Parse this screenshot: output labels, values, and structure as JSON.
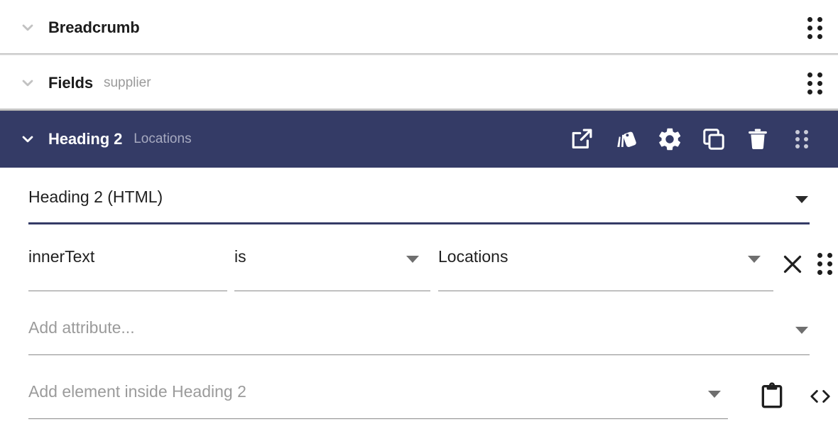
{
  "theme": {
    "accent": "#343b66",
    "selected_header_bg": "#343b66",
    "selected_header_text": "#ffffff",
    "selected_header_subtext": "#a7aac0",
    "page_bg": "#ffffff",
    "title_text": "#1b1b1b",
    "muted_text": "#9a9a9a",
    "field_underline": "#8a8a8a",
    "placeholder_text": "#9b9b9b",
    "drag_dot": "#1e1e1e",
    "drag_dot_light": "#c9cbd8"
  },
  "sections": [
    {
      "title": "Breadcrumb",
      "subtitle": "",
      "expand_icon": "chevron-down-icon",
      "drag_icon": "drag-handle-icon",
      "selected": false
    },
    {
      "title": "Fields",
      "subtitle": "supplier",
      "expand_icon": "chevron-down-icon",
      "drag_icon": "drag-handle-icon",
      "selected": false
    }
  ],
  "selected_section": {
    "title": "Heading 2",
    "subtitle": "Locations",
    "expand_icon": "chevron-down-icon",
    "toolbar": [
      {
        "name": "open-in-new-icon",
        "label": "Open in new"
      },
      {
        "name": "style-swatches-icon",
        "label": "Style"
      },
      {
        "name": "gear-icon",
        "label": "Settings"
      },
      {
        "name": "copy-icon",
        "label": "Duplicate"
      },
      {
        "name": "trash-icon",
        "label": "Delete"
      },
      {
        "name": "drag-handle-icon",
        "label": "Reorder"
      }
    ]
  },
  "editor": {
    "element_type": {
      "value": "Heading 2 (HTML)",
      "dropdown_icon": "caret-down-icon",
      "active": true
    },
    "attribute_rows": [
      {
        "name_value": "innerText",
        "operator_value": "is",
        "operator_dropdown_icon": "caret-down-icon",
        "value_value": "Locations",
        "value_dropdown_icon": "caret-down-icon",
        "remove_icon": "close-icon",
        "drag_icon": "drag-handle-icon"
      }
    ],
    "add_attribute": {
      "placeholder": "Add attribute...",
      "dropdown_icon": "caret-down-icon"
    },
    "add_element": {
      "placeholder": "Add element inside Heading 2",
      "dropdown_icon": "caret-down-icon",
      "paste_icon": "clipboard-paste-icon",
      "code_icon": "code-brackets-icon"
    }
  }
}
